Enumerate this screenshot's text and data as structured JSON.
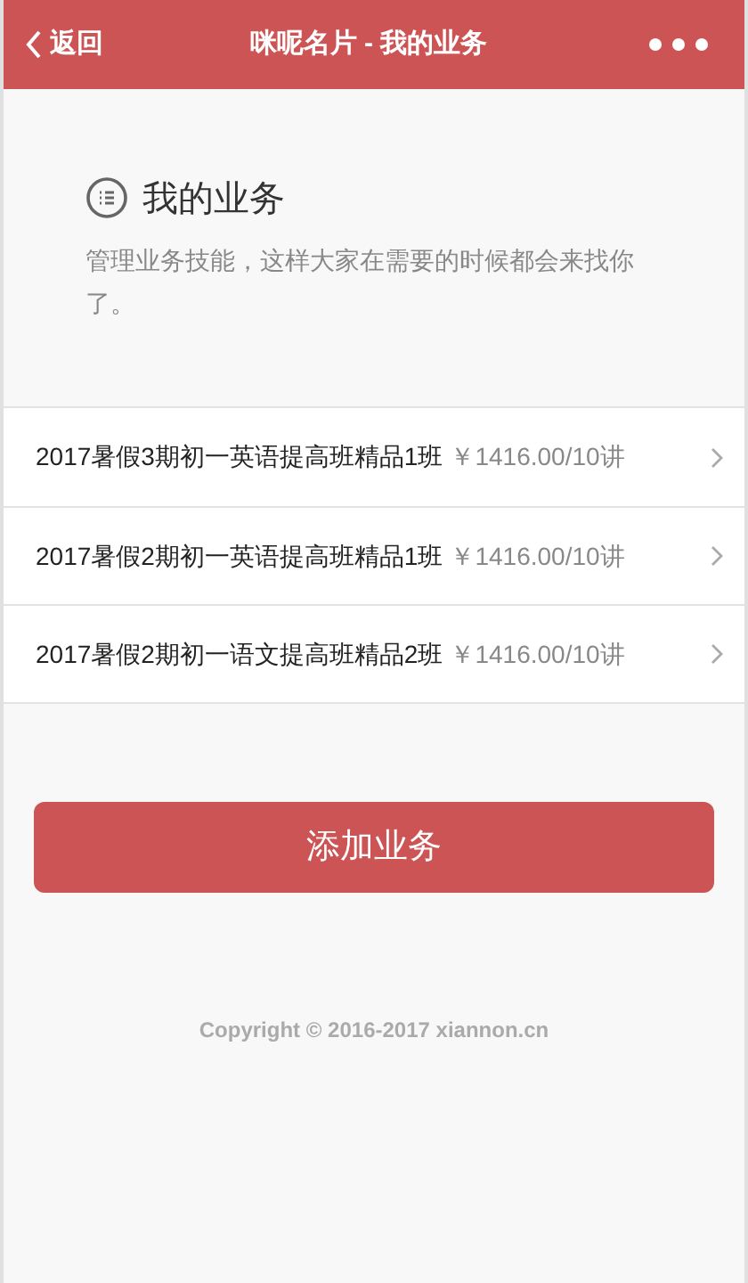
{
  "header": {
    "back": "返回",
    "title": "咪呢名片 - 我的业务"
  },
  "intro": {
    "title": "我的业务",
    "description": "管理业务技能，这样大家在需要的时候都会来找你了。"
  },
  "services": [
    {
      "name": "2017暑假3期初一英语提高班精品1班",
      "price": "￥1416.00/10讲"
    },
    {
      "name": "2017暑假2期初一英语提高班精品1班",
      "price": "￥1416.00/10讲"
    },
    {
      "name": "2017暑假2期初一语文提高班精品2班",
      "price": "￥1416.00/10讲"
    }
  ],
  "add_button": "添加业务",
  "footer": "Copyright © 2016-2017 xiannon.cn"
}
